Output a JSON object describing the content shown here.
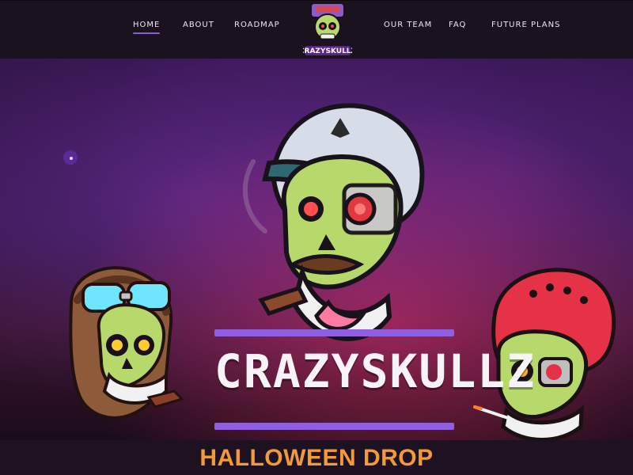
{
  "nav": {
    "left": [
      {
        "label": "HOME"
      },
      {
        "label": "ABOUT"
      },
      {
        "label": "ROADMAP"
      }
    ],
    "right": [
      {
        "label": "OUR TEAM"
      },
      {
        "label": "FAQ"
      },
      {
        "label": "FUTURE PLANS"
      }
    ],
    "active_label": "HOME"
  },
  "brand": {
    "logo_text": "CRAZYSKULLZ"
  },
  "hero": {
    "title": "CRAZYSKULLZ",
    "accent_color": "#8f5fe0",
    "bubble_icon": "dot-icon"
  },
  "footer": {
    "drop_title": "HALLOWEEN DROP",
    "drop_color": "#f09a3a"
  }
}
